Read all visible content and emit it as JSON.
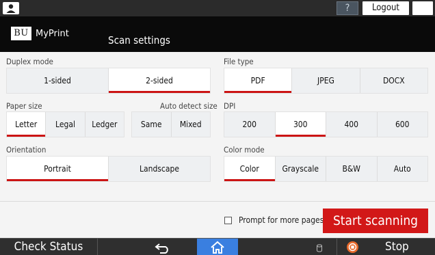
{
  "topbar": {
    "help_label": "?",
    "logout_label": "Logout"
  },
  "header": {
    "brand_logo": "BU",
    "brand_name": "MyPrint",
    "title": "Scan settings"
  },
  "duplex": {
    "label": "Duplex mode",
    "options": [
      "1-sided",
      "2-sided"
    ],
    "selected": "2-sided"
  },
  "file_type": {
    "label": "File type",
    "options": [
      "PDF",
      "JPEG",
      "DOCX"
    ],
    "selected": "PDF"
  },
  "paper_size": {
    "label": "Paper size",
    "options": [
      "Letter",
      "Legal",
      "Ledger"
    ],
    "selected": "Letter"
  },
  "auto_detect": {
    "label": "Auto detect size",
    "options": [
      "Same",
      "Mixed"
    ]
  },
  "dpi": {
    "label": "DPI",
    "options": [
      "200",
      "300",
      "400",
      "600"
    ],
    "selected": "300"
  },
  "orientation": {
    "label": "Orientation",
    "options": [
      "Portrait",
      "Landscape"
    ],
    "selected": "Portrait"
  },
  "color_mode": {
    "label": "Color mode",
    "options": [
      "Color",
      "Grayscale",
      "B&W",
      "Auto"
    ],
    "selected": "Color"
  },
  "actions": {
    "prompt_label": "Prompt for more pages",
    "prompt_checked": false,
    "start_label": "Start scanning"
  },
  "navbar": {
    "check_status_label": "Check Status",
    "stop_label": "Stop"
  },
  "colors": {
    "accent": "#cc1414",
    "start_button": "#d21818",
    "home_button": "#3a7fe0",
    "stop_icon": "#e8692a"
  }
}
